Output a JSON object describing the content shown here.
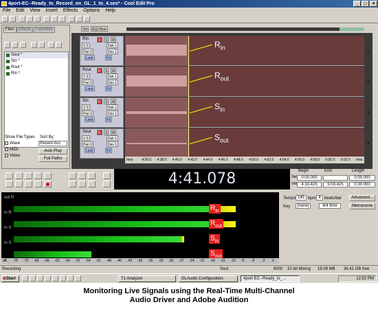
{
  "window": {
    "title": "4port-EC--Ready_to_Record_on_GL_1_to_4.ses* - Cool Edit Pro"
  },
  "menu": [
    "File",
    "Edit",
    "View",
    "Insert",
    "Effects",
    "Options",
    "Help"
  ],
  "organizer": {
    "tabs": [
      "Files",
      "Effects",
      "Favorites"
    ],
    "files": [
      "Sout *",
      "Sin *",
      "Rout *",
      "Rin *"
    ],
    "show_file_types_label": "Show File Types",
    "sort_by_label": "Sort By:",
    "file_types": [
      "Wave",
      "MIDI",
      "Video"
    ],
    "sort_value": "Recent Acc",
    "autoplay_label": "Auto Play",
    "full_paths_label": "Full Paths"
  },
  "tracks": [
    {
      "name": "Rin",
      "label_main": "R",
      "label_sub": "in",
      "num": "1"
    },
    {
      "name": "Rout",
      "label_main": "R",
      "label_sub": "out",
      "num": "2"
    },
    {
      "name": "Sin",
      "label_main": "S",
      "label_sub": "in",
      "num": "3"
    },
    {
      "name": "Sout",
      "label_main": "S",
      "label_sub": "out",
      "num": "4"
    }
  ],
  "track_controls": {
    "volume": "V 0",
    "pan": "Pan 0",
    "r": "R",
    "s": "S",
    "m": "M",
    "lock": "Lock",
    "fx": "FX"
  },
  "ruler_ticks": [
    "hms",
    "4:36.0",
    "4:38.0",
    "4:40.0",
    "4:42.0",
    "4:44.0",
    "4:46.0",
    "4:48.0",
    "4:50.0",
    "4:52.0",
    "4:54.0",
    "4:56.0",
    "4:58.0",
    "5:00.0",
    "5:02.0",
    "hms"
  ],
  "clock": "4:41.078",
  "selection": {
    "begin_label": "Begin",
    "end_label": "End",
    "length_label": "Length",
    "sel_label": "Sel",
    "view_label": "View",
    "sel_begin": "0:00.000",
    "sel_end": "",
    "sel_length": "0:00.000",
    "view_begin": "4:33.425",
    "view_end": "5:03.425",
    "view_length": "0:30.000"
  },
  "tempo": {
    "tempo_label": "Tempo",
    "tempo_value": "145",
    "bpm_label": "bpm",
    "beats_value": "4",
    "beats_label": "beats/bar",
    "advanced_label": "Advanced...",
    "key_label": "Key",
    "key_value": "(none)",
    "time_value": "4/4 time",
    "metronome_label": "Metronome"
  },
  "meters": {
    "tags": [
      "out R",
      "in R",
      "in S",
      "in S"
    ],
    "labels": [
      {
        "main": "R",
        "sub": "in"
      },
      {
        "main": "R",
        "sub": "out"
      },
      {
        "main": "S",
        "sub": "in"
      },
      {
        "main": "S",
        "sub": "out"
      }
    ],
    "levels": [
      0.86,
      0.86,
      0.66,
      0.3
    ],
    "scale": [
      "dB",
      "-75",
      "-72",
      "-69",
      "-66",
      "-63",
      "-60",
      "-57",
      "-54",
      "-51",
      "-48",
      "-45",
      "-42",
      "-39",
      "-36",
      "-33",
      "-30",
      "-27",
      "-24",
      "-21",
      "-18",
      "-15",
      "-12",
      "-9",
      "-6",
      "-3",
      "0"
    ]
  },
  "status": {
    "state": "Recording",
    "track": "Sout",
    "rate": "8000",
    "bits": "32-bit Mixing",
    "size": "19.08 MB",
    "free": "36.41 GB free"
  },
  "taskbar": {
    "start": "Start",
    "tasks": [
      "T1 Analyzer",
      "GLAudio Configuration",
      "4port-EC--Ready_to_..."
    ],
    "time": "12:52 PM"
  },
  "caption": {
    "line1": "Monitoring Live Signals using the Real-Time Multi-Channel",
    "line2": "Audio Driver and Adobe Audition"
  },
  "colors": {
    "lane_bg": "#6a3b3b",
    "meter_label": "#e82020",
    "meter_green": "#19c219",
    "meter_hot": "#ffef20",
    "clock_bg": "#000000"
  }
}
